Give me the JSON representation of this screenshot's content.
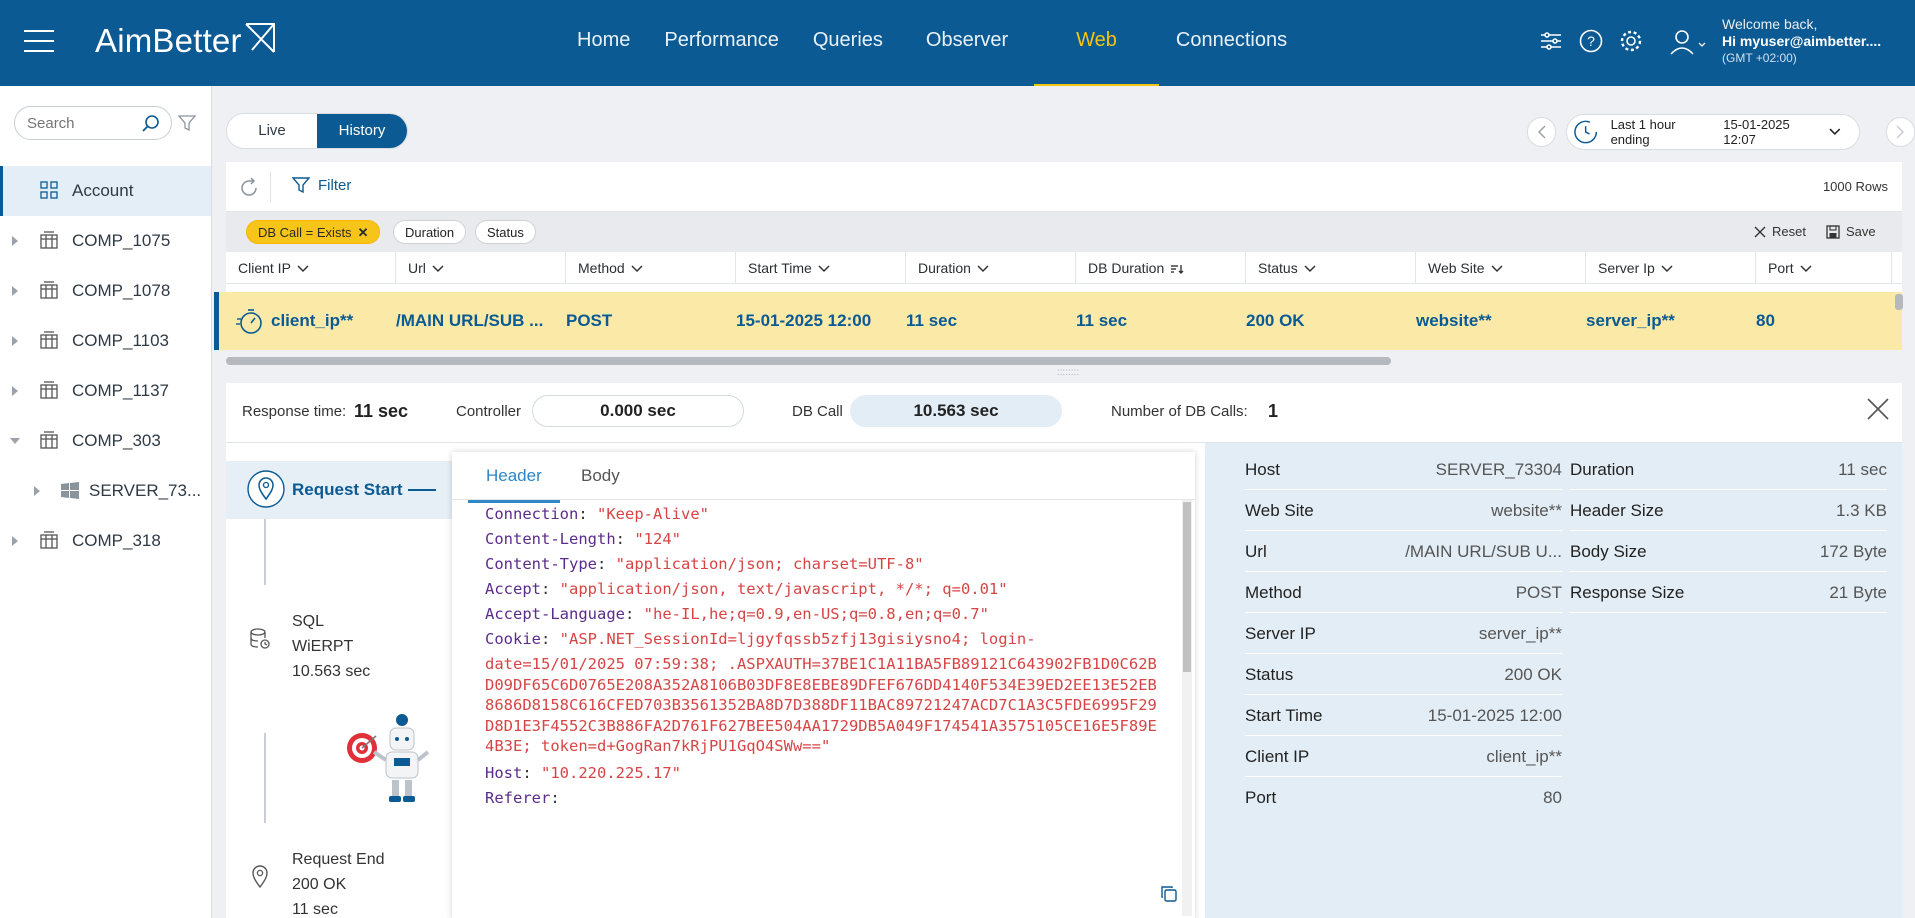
{
  "app": {
    "logo_text": "AimBetter"
  },
  "nav": {
    "items": [
      "Home",
      "Performance",
      "Queries",
      "Observer",
      "Web",
      "Connections"
    ],
    "active": "Web"
  },
  "user": {
    "welcome": "Welcome back,",
    "hi": "Hi myuser@aimbetter....",
    "timezone": "(GMT +02:00)"
  },
  "sidebar": {
    "search_placeholder": "Search",
    "items": [
      {
        "label": "Account",
        "icon": "grid-icon",
        "selected": true
      },
      {
        "label": "COMP_1075",
        "icon": "company-icon"
      },
      {
        "label": "COMP_1078",
        "icon": "company-icon"
      },
      {
        "label": "COMP_1103",
        "icon": "company-icon"
      },
      {
        "label": "COMP_1137",
        "icon": "company-icon"
      },
      {
        "label": "COMP_303",
        "icon": "company-icon",
        "expanded": true
      },
      {
        "label": "SERVER_73...",
        "icon": "windows-icon",
        "child": true
      },
      {
        "label": "COMP_318",
        "icon": "company-icon"
      }
    ]
  },
  "mode": {
    "live": "Live",
    "history": "History",
    "active": "History"
  },
  "time_range": {
    "label": "Last 1 hour ending",
    "value": "15-01-2025 12:07"
  },
  "toolbar": {
    "filter": "Filter",
    "rows": "1000 Rows",
    "reset": "Reset",
    "save": "Save"
  },
  "chips": [
    {
      "label": "DB Call = Exists",
      "active": true
    },
    {
      "label": "Duration",
      "active": false
    },
    {
      "label": "Status",
      "active": false
    }
  ],
  "table": {
    "columns": [
      "Client IP",
      "Url",
      "Method",
      "Start Time",
      "Duration",
      "DB Duration",
      "Status",
      "Web Site",
      "Server Ip",
      "Port"
    ],
    "row": [
      "client_ip**",
      "/MAIN URL/SUB ...",
      "POST",
      "15-01-2025 12:00",
      "11 sec",
      "11 sec",
      "200 OK",
      "website**",
      "server_ip**",
      "80"
    ]
  },
  "detail": {
    "response_time_label": "Response time:",
    "response_time": "11 sec",
    "controller_label": "Controller",
    "controller": "0.000 sec",
    "db_call_label": "DB Call",
    "db_call": "10.563 sec",
    "num_db_calls_label": "Number of DB Calls:",
    "num_db_calls": "1"
  },
  "timeline": {
    "request_start": "Request Start",
    "sql_lines": [
      "SQL",
      "WiERPT",
      "10.563 sec"
    ],
    "end_lines": [
      "Request End",
      "200 OK",
      "11 sec"
    ]
  },
  "header_body": {
    "tabs": [
      "Header",
      "Body"
    ],
    "active_tab": "Header",
    "headers": [
      {
        "key": "Connection",
        "value": "\"Keep-Alive\""
      },
      {
        "key": "Content-Length",
        "value": "\"124\""
      },
      {
        "key": "Content-Type",
        "value": "\"application/json; charset=UTF-8\""
      },
      {
        "key": "Accept",
        "value": "\"application/json, text/javascript, */*; q=0.01\""
      },
      {
        "key": "Accept-Language",
        "value": "\"he-IL,he;q=0.9,en-US;q=0.8,en;q=0.7\""
      }
    ],
    "cookie_key": "Cookie",
    "cookie_first": "\"ASP.NET_SessionId=ljgyfqssb5zfj13gisiysno4; login-",
    "cookie_rest": "date=15/01/2025 07:59:38; .ASPXAUTH=37BE1C1A11BA5FB89121C643902FB1D0C62BD09DF65C6D0765E208A352A8106B03DF8E8EBE89DFEF676DD4140F534E39ED2EE13E52EB8686D8158C616CFED703B3561352BA8D7D388DF11BAC89721247ACD7C1A3C5FDE6995F29D8D1E3F4552C3B886FA2D761F627BEE504AA1729DB5A049F174541A3575105CE16E5F89E4B3E; token=d+GogRan7kRjPU1GqO4SWw==\"",
    "host_key": "Host",
    "host_value": "\"10.220.225.17\"",
    "referer_key": "Referer"
  },
  "properties": {
    "left": [
      {
        "k": "Host",
        "v": "SERVER_73304"
      },
      {
        "k": "Web Site",
        "v": "website**"
      },
      {
        "k": "Url",
        "v": "/MAIN URL/SUB U..."
      },
      {
        "k": "Method",
        "v": "POST"
      },
      {
        "k": "Server IP",
        "v": "server_ip**"
      },
      {
        "k": "Status",
        "v": "200 OK"
      },
      {
        "k": "Start Time",
        "v": "15-01-2025 12:00"
      },
      {
        "k": "Client IP",
        "v": "client_ip**"
      },
      {
        "k": "Port",
        "v": "80"
      }
    ],
    "right": [
      {
        "k": "Duration",
        "v": "11 sec"
      },
      {
        "k": "Header Size",
        "v": "1.3 KB"
      },
      {
        "k": "Body Size",
        "v": "172 Byte"
      },
      {
        "k": "Response Size",
        "v": "21 Byte"
      }
    ]
  },
  "colors": {
    "brand": "#0b5a93",
    "active_nav": "#f2c511",
    "selected_row": "#fbe9a8",
    "chip_active": "#f7c41a"
  }
}
